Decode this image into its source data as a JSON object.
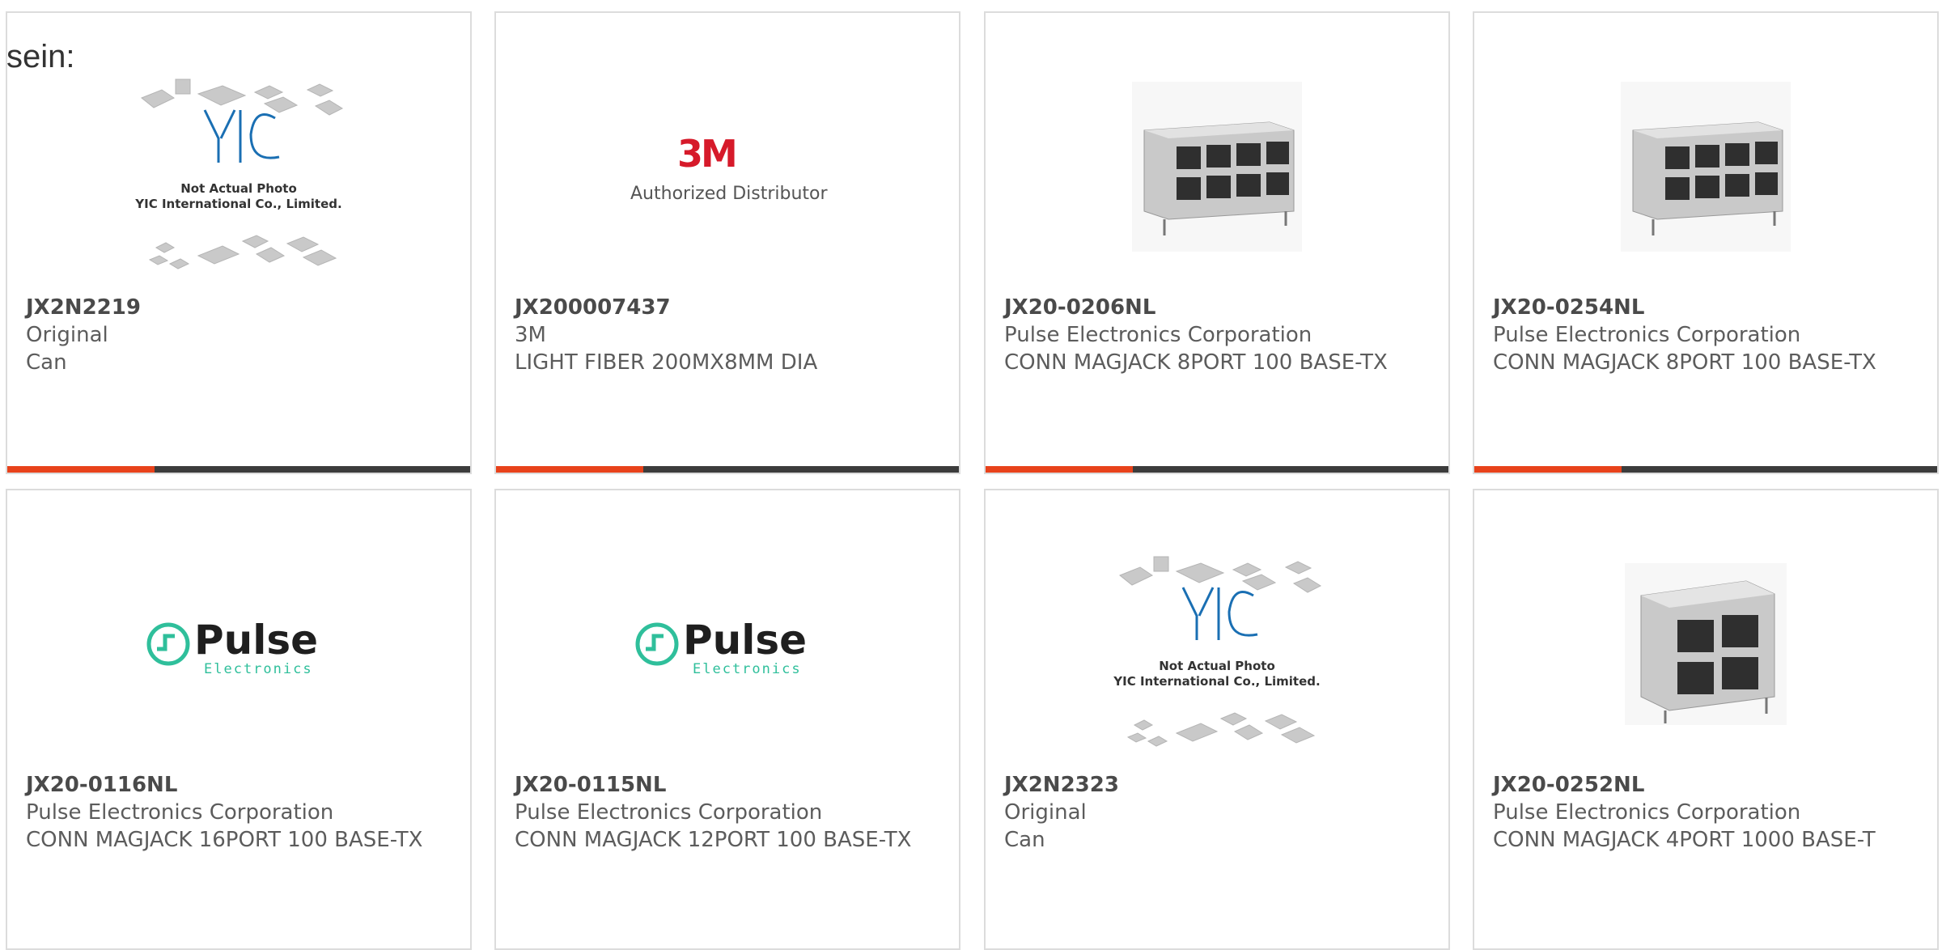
{
  "lead_text": "sein:",
  "accent_color": "#e8421b",
  "cards": [
    {
      "part": "JX2N2219",
      "manufacturer": "Original",
      "description": "Can",
      "image": "yic-placeholder",
      "photo_caption_1": "Not Actual Photo",
      "photo_caption_2": "YIC International Co., Limited."
    },
    {
      "part": "JX200007437",
      "manufacturer": "3M",
      "description": "LIGHT FIBER 200MX8MM DIA",
      "image": "3m-logo",
      "logo_text": "3M",
      "logo_sub": "Authorized Distributor"
    },
    {
      "part": "JX20-0206NL",
      "manufacturer": "Pulse Electronics Corporation",
      "description": "CONN MAGJACK 8PORT 100 BASE-TX",
      "image": "rj45-8port-photo"
    },
    {
      "part": "JX20-0254NL",
      "manufacturer": "Pulse Electronics Corporation",
      "description": "CONN MAGJACK 8PORT 100 BASE-TX",
      "image": "rj45-8port-photo"
    },
    {
      "part": "JX20-0116NL",
      "manufacturer": "Pulse Electronics Corporation",
      "description": "CONN MAGJACK 16PORT 100 BASE-TX",
      "image": "pulse-logo",
      "logo_text": "Pulse",
      "logo_sub": "Electronics"
    },
    {
      "part": "JX20-0115NL",
      "manufacturer": "Pulse Electronics Corporation",
      "description": "CONN MAGJACK 12PORT 100 BASE-TX",
      "image": "pulse-logo",
      "logo_text": "Pulse",
      "logo_sub": "Electronics"
    },
    {
      "part": "JX2N2323",
      "manufacturer": "Original",
      "description": "Can",
      "image": "yic-placeholder",
      "photo_caption_1": "Not Actual Photo",
      "photo_caption_2": "YIC International Co., Limited."
    },
    {
      "part": "JX20-0252NL",
      "manufacturer": "Pulse Electronics Corporation",
      "description": "CONN MAGJACK 4PORT 1000 BASE-T",
      "image": "rj45-4port-photo"
    }
  ]
}
